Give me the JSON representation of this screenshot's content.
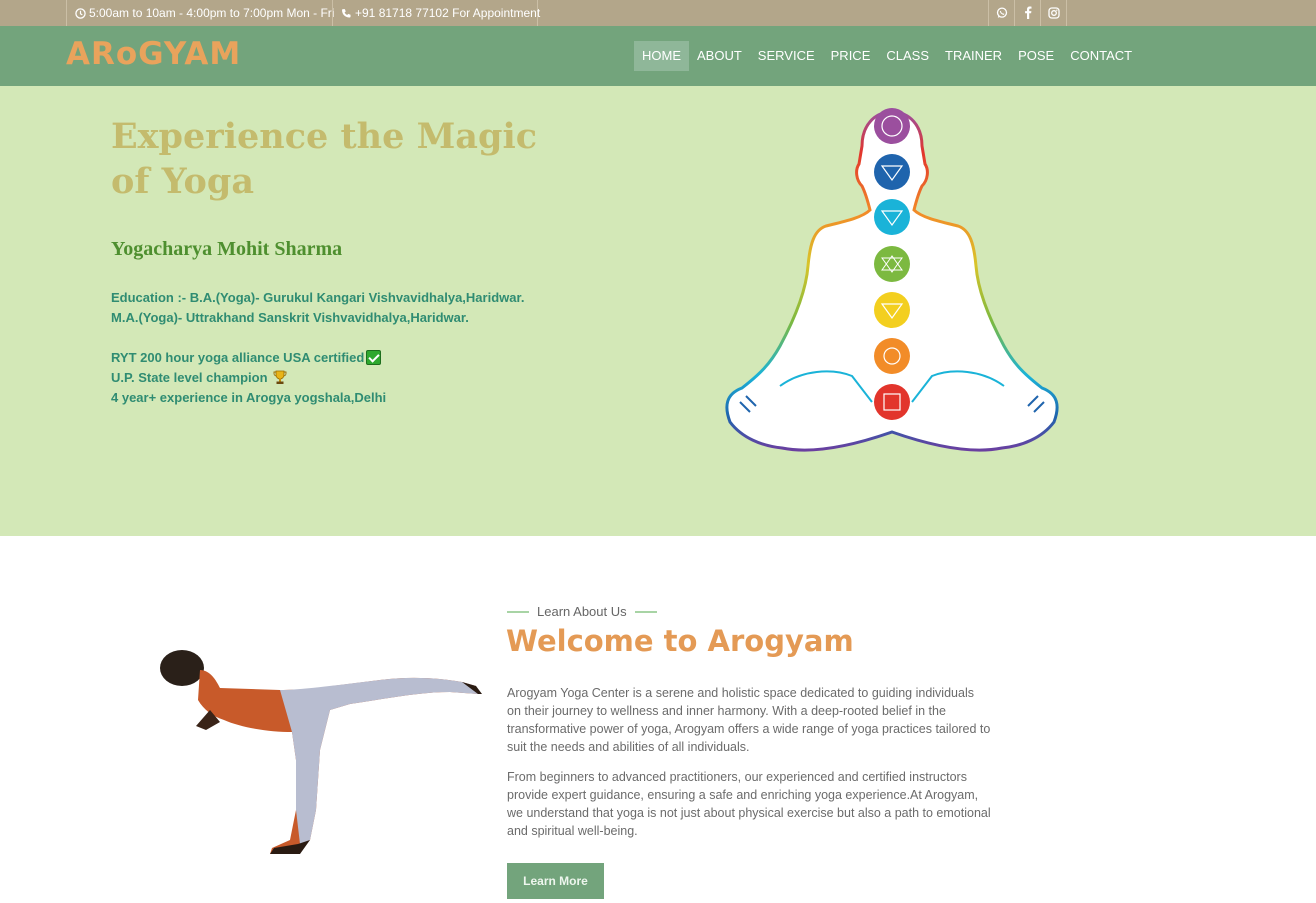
{
  "topbar": {
    "hours": "5:00am to 10am - 4:00pm to 7:00pm",
    "days": "Mon - Fri",
    "phone": "+91 81718 77102",
    "appointment": "For Appointment",
    "social_icons": [
      "whatsapp-icon",
      "facebook-icon",
      "instagram-icon"
    ]
  },
  "nav": {
    "logo": "ARoGYAM",
    "items": [
      {
        "label": "HOME",
        "active": true
      },
      {
        "label": "ABOUT"
      },
      {
        "label": "SERVICE"
      },
      {
        "label": "PRICE"
      },
      {
        "label": "CLASS"
      },
      {
        "label": "TRAINER"
      },
      {
        "label": "POSE"
      },
      {
        "label": "CONTACT"
      }
    ]
  },
  "hero": {
    "title": "Experience the Magic of Yoga",
    "name": "Yogacharya Mohit Sharma",
    "education_1": "Education :- B.A.(Yoga)- Gurukul Kangari Vishvavidhalya,Haridwar.",
    "education_2": "M.A.(Yoga)- Uttrakhand Sanskrit Vishvavidhalya,Haridwar.",
    "cert": "RYT 200 hour yoga alliance USA certified",
    "champion": "U.P. State level champion",
    "experience": "4 year+ experience in Arogya yogshala,Delhi"
  },
  "about": {
    "label": "Learn About Us",
    "title": "Welcome to Arogyam",
    "p1": "Arogyam Yoga Center is a serene and holistic space dedicated to guiding individuals on their journey to wellness and inner harmony. With a deep-rooted belief in the transformative power of yoga, Arogyam offers a wide range of yoga practices tailored to suit the needs and abilities of all individuals.",
    "p2": "From beginners to advanced practitioners, our experienced and certified instructors provide expert guidance, ensuring a safe and enriching yoga experience.At Arogyam, we understand that yoga is not just about physical exercise but also a path to emotional and spiritual well-being.",
    "button": "Learn More"
  },
  "colors": {
    "topbar": "#b3a68a",
    "nav": "#73a47c",
    "logo": "#e9a35c",
    "hero_bg": "#d3e8b7",
    "hero_title": "#c4bb6d",
    "about_title": "#e49a55",
    "chakras": [
      "#9b4f9e",
      "#1f64ad",
      "#1ab3d8",
      "#7cb940",
      "#f3cf1f",
      "#f28c28",
      "#e2352c"
    ]
  }
}
